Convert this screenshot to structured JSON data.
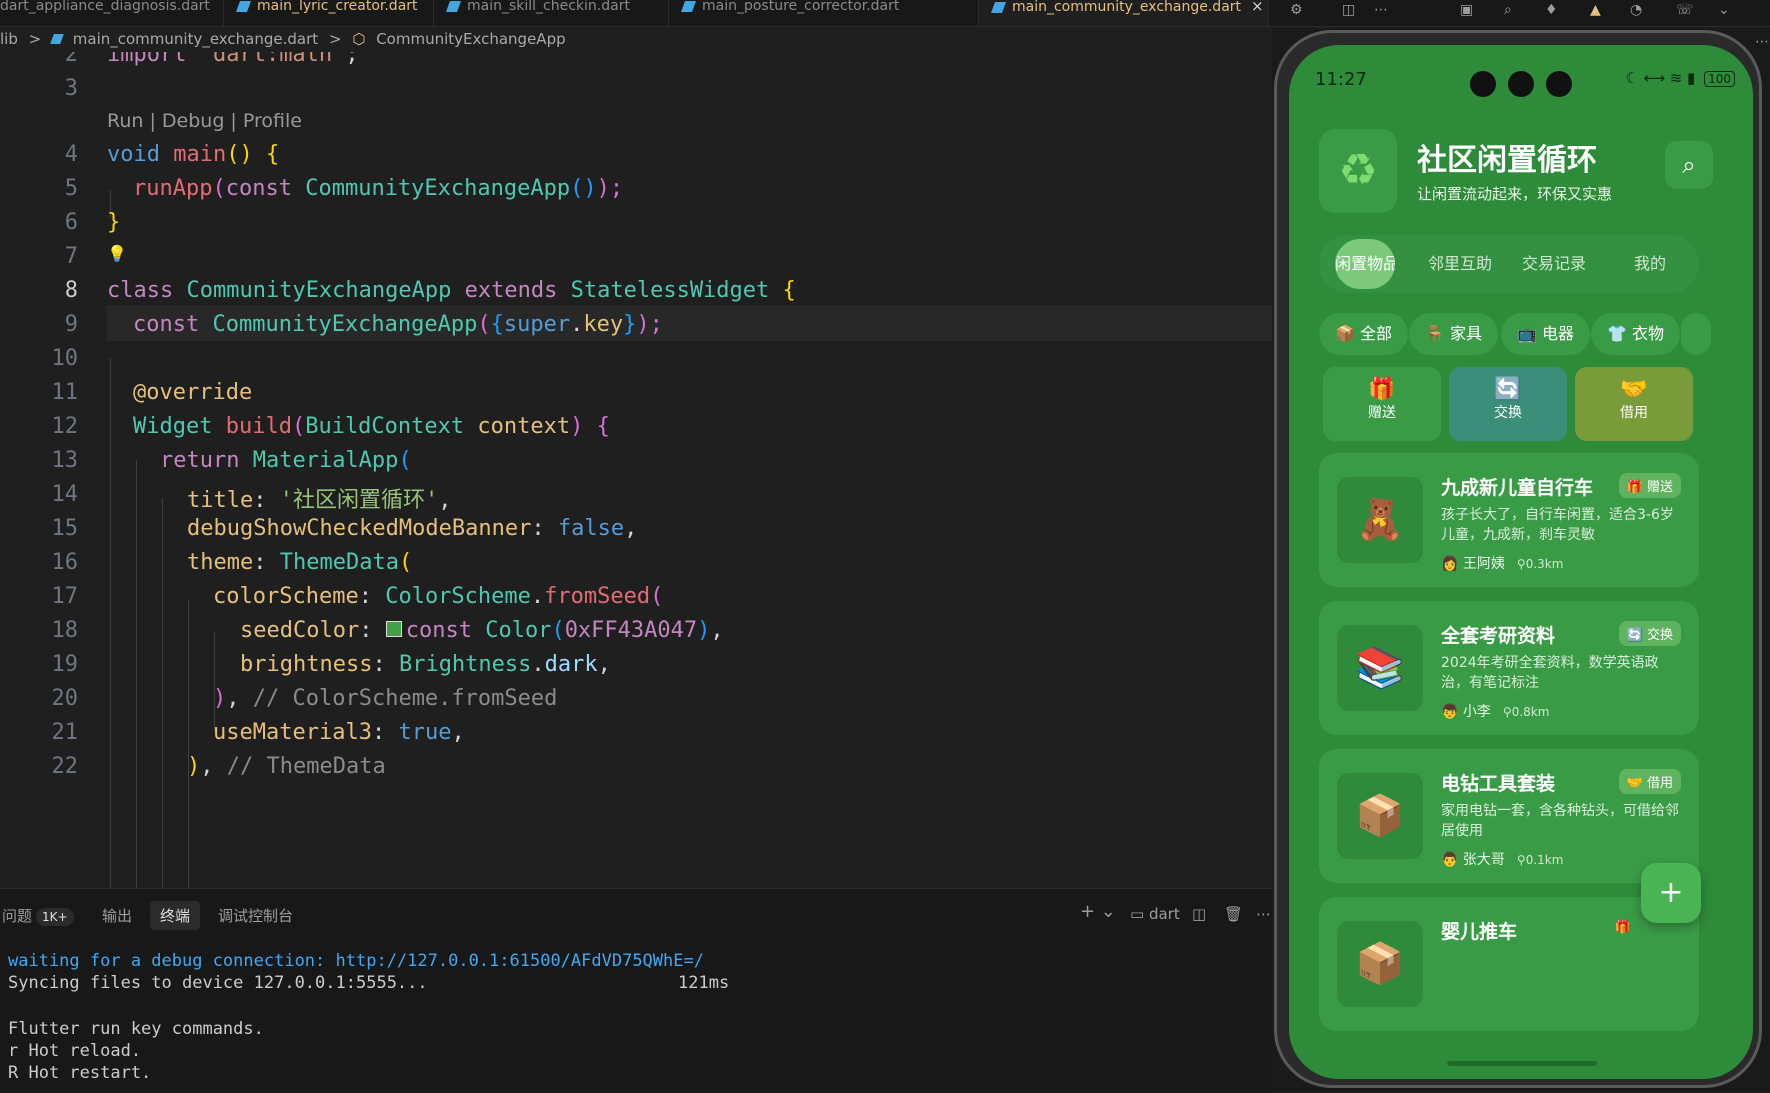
{
  "tabs": [
    {
      "label": "dart_appliance_diagnosis.dart",
      "active": false
    },
    {
      "label": "main_lyric_creator.dart",
      "active": false
    },
    {
      "label": "main_skill_checkin.dart",
      "active": false
    },
    {
      "label": "main_posture_corrector.dart",
      "active": false
    },
    {
      "label": "main_community_exchange.dart",
      "active": true
    }
  ],
  "tab_close": "×",
  "breadcrumb": {
    "root": "lib",
    "sep": ">",
    "file": "main_community_exchange.dart",
    "symbol": "CommunityExchangeApp"
  },
  "editor": {
    "current_line": "8",
    "codelens": "Run | Debug | Profile",
    "line_numbers": [
      "2",
      "3",
      "4",
      "5",
      "6",
      "7",
      "8",
      "9",
      "10",
      "11",
      "12",
      "13",
      "14",
      "15",
      "16",
      "17",
      "18",
      "19",
      "20",
      "21",
      "22"
    ],
    "code": {
      "l2a": "import ",
      "l2b": "'dart:math'",
      "l2c": ";",
      "l4a": "void ",
      "l4b": "main",
      "l4c": "() ",
      "l4d": "{",
      "l5a": "runApp",
      "l5b": "(",
      "l5c": "const ",
      "l5d": "CommunityExchangeApp",
      "l5e": "()",
      "l5f": ");",
      "l6a": "}",
      "l8a": "class ",
      "l8b": "CommunityExchangeApp ",
      "l8c": "extends ",
      "l8d": "StatelessWidget ",
      "l8e": "{",
      "l9a": "const ",
      "l9b": "CommunityExchangeApp",
      "l9c": "(",
      "l9d": "{",
      "l9e": "super",
      "l9f": ".",
      "l9g": "key",
      "l9h": "}",
      "l9i": ");",
      "l11a": "@override",
      "l12a": "Widget ",
      "l12b": "build",
      "l12c": "(",
      "l12d": "BuildContext ",
      "l12e": "context",
      "l12f": ") ",
      "l12g": "{",
      "l13a": "return ",
      "l13b": "MaterialApp",
      "l13c": "(",
      "l14a": "title",
      ": ": "",
      "l14b": ": ",
      "l14c": "'社区闲置循环'",
      "l14d": ",",
      "l15a": "debugShowCheckedModeBanner",
      "l15b": ": ",
      "l15c": "false",
      "l15d": ",",
      "l16a": "theme",
      "l16b": ": ",
      "l16c": "ThemeData",
      "l16d": "(",
      "l17a": "colorScheme",
      "l17b": ": ",
      "l17c": "ColorScheme",
      "l17d": ".",
      "l17e": "fromSeed",
      "l17f": "(",
      "l18a": "seedColor",
      "l18b": ": ",
      "l18c": "const ",
      "l18d": "Color",
      "l18e": "(",
      "l18f": "0xFF43A047",
      "l18g": ")",
      ",": ",",
      "l19a": "brightness",
      "l19b": ": ",
      "l19c": "Brightness",
      "l19d": ".",
      "l19e": "dark",
      "l19f": ",",
      "l20a": ")",
      ",  ": "",
      "l20b": ", ",
      "l20c": "// ColorScheme.fromSeed",
      "l21a": "useMaterial3",
      "l21b": ": ",
      "l21c": "true",
      "l21d": ",",
      "l22a": ")",
      "l22b": ", ",
      "l22c": "// ThemeData"
    }
  },
  "panel": {
    "tabs": [
      "问题",
      "输出",
      "终端",
      "调试控制台"
    ],
    "problems_count": "1K+",
    "active_tab": "终端",
    "dart_label": "dart",
    "terminal_lines": [
      "waiting for a debug connection: http://127.0.0.1:61500/AFdVD75QWhE=/",
      "Syncing files to device 127.0.0.1:5555...",
      "121ms",
      "Flutter run key commands.",
      "r Hot reload.",
      "R Hot restart."
    ]
  },
  "phone": {
    "status_time": "11:27",
    "battery": "100",
    "app_icon": "recycle-icon",
    "title": "社区闲置循环",
    "subtitle": "让闲置流动起来，环保又实惠",
    "nav_tabs": [
      "闲置物品",
      "邻里互助",
      "交易记录",
      "我的"
    ],
    "categories": [
      "全部",
      "家具",
      "电器",
      "衣物"
    ],
    "category_icons": [
      "📦",
      "🪑",
      "📺",
      "👕"
    ],
    "modes": [
      {
        "label": "赠送",
        "icon": "🎁"
      },
      {
        "label": "交换",
        "icon": "🔄"
      },
      {
        "label": "借用",
        "icon": "🤝"
      }
    ],
    "items": [
      {
        "title": "九成新儿童自行车",
        "tag": "赠送",
        "tag_icon": "🎁",
        "desc": "孩子长大了，自行车闲置，适合3-6岁儿童，九成新，刹车灵敏",
        "user": "王阿姨",
        "user_icon": "👩",
        "distance": "0.3km",
        "img": "🧸"
      },
      {
        "title": "全套考研资料",
        "tag": "交换",
        "tag_icon": "🔄",
        "desc": "2024年考研全套资料，数学英语政治，有笔记标注",
        "user": "小李",
        "user_icon": "👦",
        "distance": "0.8km",
        "img": "📚"
      },
      {
        "title": "电钻工具套装",
        "tag": "借用",
        "tag_icon": "🤝",
        "desc": "家用电钻一套，含各种钻头，可借给邻居使用",
        "user": "张大哥",
        "user_icon": "👨",
        "distance": "0.1km",
        "img": "📦"
      },
      {
        "title": "婴儿推车",
        "tag": "",
        "tag_icon": "🎁",
        "desc": "",
        "user": "",
        "user_icon": "",
        "distance": "",
        "img": "📦"
      }
    ],
    "fab": "+"
  },
  "colors": {
    "accent": "#43A047",
    "seed": "#43A047"
  }
}
